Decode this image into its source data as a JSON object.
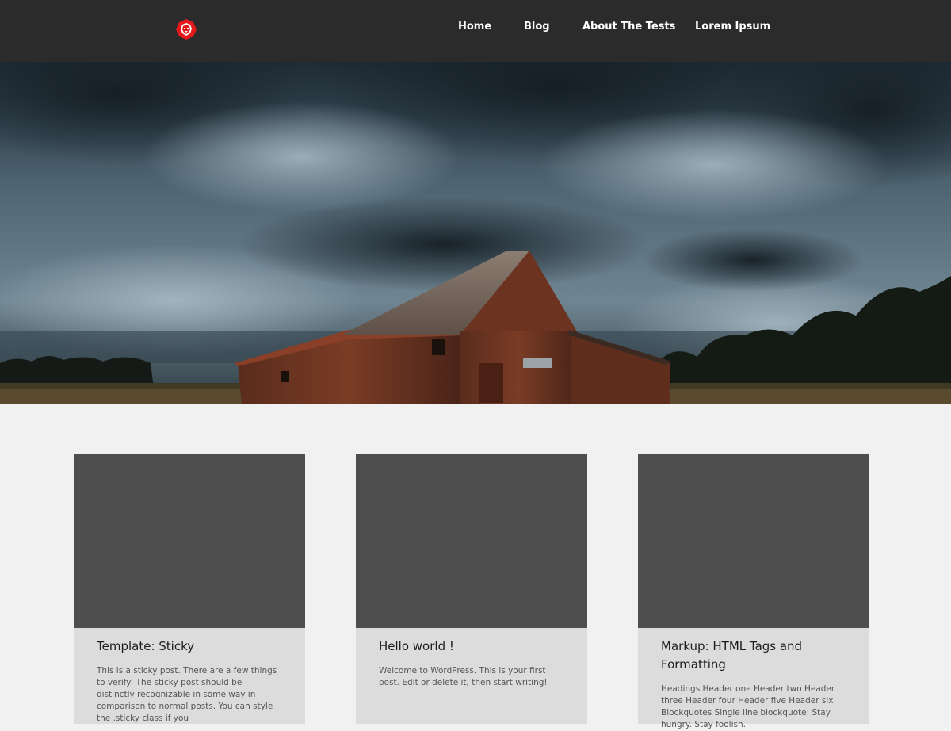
{
  "header": {
    "nav": [
      {
        "label": "Home"
      },
      {
        "label": "Blog"
      },
      {
        "label": "About The Tests"
      },
      {
        "label": "Lorem Ipsum"
      }
    ],
    "logo_icon": "lion-head-icon",
    "logo_color": "#e3191c"
  },
  "hero": {
    "image": "storm-clouds-barn-landscape"
  },
  "posts": [
    {
      "title": "Template: Sticky",
      "excerpt": "This is a sticky post. There are a few things to verify: The sticky post should be distinctly recognizable in some way in comparison to normal posts. You can style the .sticky class if you"
    },
    {
      "title": "Hello world !",
      "excerpt": "Welcome to WordPress. This is your first post. Edit or delete it, then start writing!"
    },
    {
      "title": "Markup: HTML Tags and Formatting",
      "excerpt": "Headings Header one Header two Header three Header four Header five Header six Blockquotes Single line blockquote: Stay hungry. Stay foolish."
    }
  ],
  "colors": {
    "header_bg": "#2b2b2b",
    "page_bg": "#f1f1f1",
    "card_bg": "#dcdcdc",
    "thumb_bg": "#4e4e4e"
  }
}
